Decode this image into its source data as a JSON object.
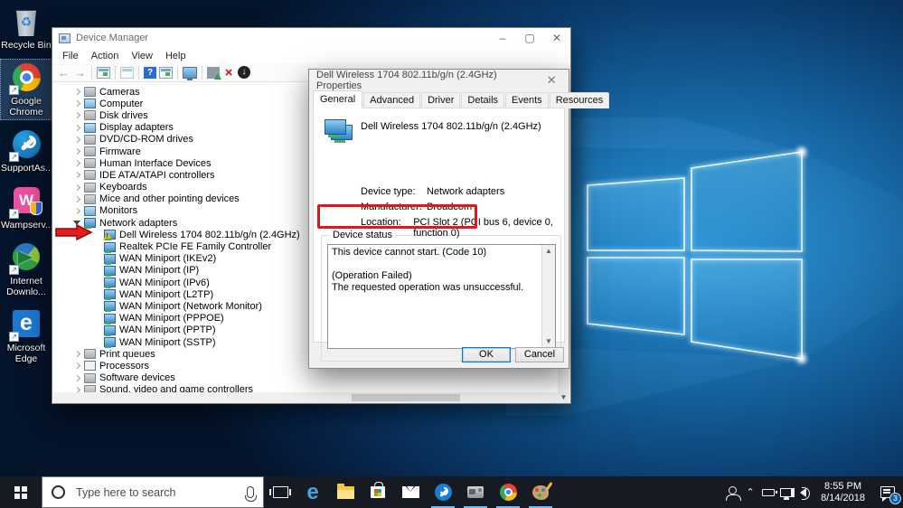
{
  "desktop": {
    "icons": [
      {
        "name": "recycle-bin",
        "label": "Recycle Bin",
        "selected": false,
        "shortcut": false
      },
      {
        "name": "google-chrome",
        "label": "Google Chrome",
        "selected": true,
        "shortcut": true
      },
      {
        "name": "supportassist",
        "label": "SupportAs...",
        "selected": false,
        "shortcut": true
      },
      {
        "name": "wampserver",
        "label": "Wampserv...",
        "selected": false,
        "shortcut": true
      },
      {
        "name": "internet-download-manager",
        "label": "Internet Downlo...",
        "selected": false,
        "shortcut": true
      },
      {
        "name": "microsoft-edge",
        "label": "Microsoft Edge",
        "selected": false,
        "shortcut": true
      }
    ]
  },
  "device_manager": {
    "title": "Device Manager",
    "window_controls": [
      "minimize",
      "maximize",
      "close"
    ],
    "menus": [
      "File",
      "Action",
      "View",
      "Help"
    ],
    "toolbar_icons": [
      "back-icon",
      "forward-icon",
      "sep",
      "console-window-icon",
      "sep",
      "export-list-icon",
      "sep",
      "help-icon",
      "properties-window-icon",
      "sep",
      "computer-icon",
      "sep",
      "update-driver-icon",
      "uninstall-device-icon",
      "disable-device-icon"
    ],
    "tree": [
      {
        "label": "Cameras",
        "level": 0,
        "expand": "collapsed",
        "icon": "camera-icon",
        "style": "gray"
      },
      {
        "label": "Computer",
        "level": 0,
        "expand": "collapsed",
        "icon": "computer-icon",
        "style": "mon"
      },
      {
        "label": "Disk drives",
        "level": 0,
        "expand": "collapsed",
        "icon": "disk-drive-icon",
        "style": "gray"
      },
      {
        "label": "Display adapters",
        "level": 0,
        "expand": "collapsed",
        "icon": "display-adapter-icon",
        "style": "mon"
      },
      {
        "label": "DVD/CD-ROM drives",
        "level": 0,
        "expand": "collapsed",
        "icon": "dvd-drive-icon",
        "style": "gray"
      },
      {
        "label": "Firmware",
        "level": 0,
        "expand": "collapsed",
        "icon": "firmware-icon",
        "style": "gray"
      },
      {
        "label": "Human Interface Devices",
        "level": 0,
        "expand": "collapsed",
        "icon": "hid-icon",
        "style": "gray"
      },
      {
        "label": "IDE ATA/ATAPI controllers",
        "level": 0,
        "expand": "collapsed",
        "icon": "ide-controller-icon",
        "style": "gray"
      },
      {
        "label": "Keyboards",
        "level": 0,
        "expand": "collapsed",
        "icon": "keyboard-icon",
        "style": "gray"
      },
      {
        "label": "Mice and other pointing devices",
        "level": 0,
        "expand": "collapsed",
        "icon": "mouse-icon",
        "style": "gray"
      },
      {
        "label": "Monitors",
        "level": 0,
        "expand": "collapsed",
        "icon": "monitor-icon",
        "style": "mon"
      },
      {
        "label": "Network adapters",
        "level": 0,
        "expand": "expanded",
        "icon": "network-adapter-icon",
        "style": "net"
      },
      {
        "label": "Dell Wireless 1704 802.11b/g/n (2.4GHz)",
        "level": 1,
        "expand": null,
        "icon": "network-adapter-warning-icon",
        "style": "net",
        "warning": true
      },
      {
        "label": "Realtek PCIe FE Family Controller",
        "level": 1,
        "expand": null,
        "icon": "network-adapter-icon",
        "style": "net"
      },
      {
        "label": "WAN Miniport (IKEv2)",
        "level": 1,
        "expand": null,
        "icon": "network-adapter-icon",
        "style": "net"
      },
      {
        "label": "WAN Miniport (IP)",
        "level": 1,
        "expand": null,
        "icon": "network-adapter-icon",
        "style": "net"
      },
      {
        "label": "WAN Miniport (IPv6)",
        "level": 1,
        "expand": null,
        "icon": "network-adapter-icon",
        "style": "net"
      },
      {
        "label": "WAN Miniport (L2TP)",
        "level": 1,
        "expand": null,
        "icon": "network-adapter-icon",
        "style": "net"
      },
      {
        "label": "WAN Miniport (Network Monitor)",
        "level": 1,
        "expand": null,
        "icon": "network-adapter-icon",
        "style": "net"
      },
      {
        "label": "WAN Miniport (PPPOE)",
        "level": 1,
        "expand": null,
        "icon": "network-adapter-icon",
        "style": "net"
      },
      {
        "label": "WAN Miniport (PPTP)",
        "level": 1,
        "expand": null,
        "icon": "network-adapter-icon",
        "style": "net"
      },
      {
        "label": "WAN Miniport (SSTP)",
        "level": 1,
        "expand": null,
        "icon": "network-adapter-icon",
        "style": "net"
      },
      {
        "label": "Print queues",
        "level": 0,
        "expand": "collapsed",
        "icon": "printer-icon",
        "style": "gray"
      },
      {
        "label": "Processors",
        "level": 0,
        "expand": "collapsed",
        "icon": "processor-icon",
        "style": "cpu"
      },
      {
        "label": "Software devices",
        "level": 0,
        "expand": "collapsed",
        "icon": "software-device-icon",
        "style": "gray"
      },
      {
        "label": "Sound, video and game controllers",
        "level": 0,
        "expand": "collapsed",
        "icon": "sound-icon",
        "style": "gray"
      }
    ]
  },
  "properties_dialog": {
    "title": "Dell Wireless 1704 802.11b/g/n (2.4GHz) Properties",
    "tabs": [
      "General",
      "Advanced",
      "Driver",
      "Details",
      "Events",
      "Resources"
    ],
    "active_tab": "General",
    "device_name": "Dell Wireless 1704 802.11b/g/n (2.4GHz)",
    "fields": [
      {
        "label": "Device type:",
        "value": "Network adapters"
      },
      {
        "label": "Manufacturer:",
        "value": "Broadcom"
      },
      {
        "label": "Location:",
        "value": "PCI Slot 2 (PCI bus 6, device 0, function 0)"
      }
    ],
    "status_group_label": "Device status",
    "status_lines": [
      "This device cannot start. (Code 10)",
      "",
      "(Operation Failed)",
      "The requested operation was unsuccessful."
    ],
    "highlighted_status_line": "This device cannot start. (Code 10)",
    "ok_label": "OK",
    "cancel_label": "Cancel"
  },
  "annotations": {
    "color": "#e0181e",
    "arrow_target": "Dell Wireless 1704 802.11b/g/n (2.4GHz)",
    "box_target": "This device cannot start. (Code 10)"
  },
  "taskbar": {
    "search_placeholder": "Type here to search",
    "app_icons": [
      {
        "name": "task-view",
        "running": false
      },
      {
        "name": "edge",
        "running": false
      },
      {
        "name": "file-explorer",
        "running": false
      },
      {
        "name": "store",
        "running": false
      },
      {
        "name": "mail",
        "running": false
      },
      {
        "name": "supportassist",
        "running": true
      },
      {
        "name": "device-manager",
        "running": true
      },
      {
        "name": "chrome",
        "running": true
      },
      {
        "name": "paint",
        "running": true
      }
    ],
    "tray_icons": [
      "people-icon",
      "chevron-up-icon",
      "power-icon",
      "network-icon",
      "volume-icon"
    ],
    "clock": {
      "time": "8:55 PM",
      "date": "8/14/2018"
    },
    "action_center_badge": "3"
  }
}
